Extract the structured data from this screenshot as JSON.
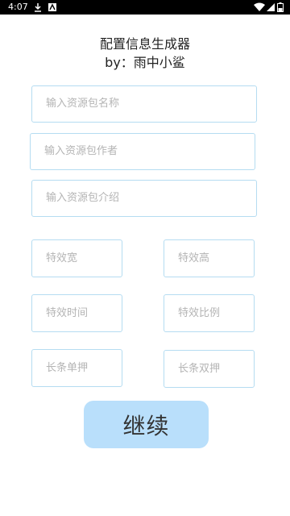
{
  "status_bar": {
    "time": "4:07",
    "icons": [
      "download-icon",
      "notification-icon",
      "wifi-icon",
      "signal-icon",
      "battery-icon"
    ]
  },
  "header": {
    "title": "配置信息生成器",
    "author": "by：雨中小鲨"
  },
  "form": {
    "pack_name_placeholder": "输入资源包名称",
    "pack_author_placeholder": "输入资源包作者",
    "pack_intro_placeholder": "输入资源包介绍",
    "effect_width_placeholder": "特效宽",
    "effect_height_placeholder": "特效高",
    "effect_time_placeholder": "特效时间",
    "effect_ratio_placeholder": "特效比例",
    "long_single_placeholder": "长条单押",
    "long_double_placeholder": "长条双押"
  },
  "actions": {
    "continue_label": "继续"
  },
  "colors": {
    "field_border": "#b5dcf1",
    "button_background": "#b9dffb",
    "placeholder_text": "#b4b4b4"
  }
}
